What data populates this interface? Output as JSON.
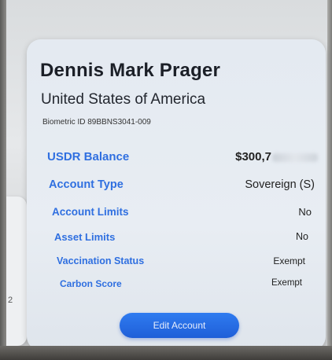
{
  "profile": {
    "name": "Dennis Mark Prager",
    "country": "United States of America",
    "biometric_id": "Biometric ID 89BBNS3041-009"
  },
  "details": [
    {
      "label": "USDR Balance",
      "value": "$300,7"
    },
    {
      "label": "Account Type",
      "value": "Sovereign (S)"
    },
    {
      "label": "Account Limits",
      "value": "No"
    },
    {
      "label": "Asset Limits",
      "value": "No"
    },
    {
      "label": "Vaccination Status",
      "value": "Exempt"
    },
    {
      "label": "Carbon Score",
      "value": "Exempt"
    }
  ],
  "actions": {
    "edit_label": "Edit Account"
  },
  "side_card": {
    "number": "2"
  },
  "colors": {
    "label_blue": "#2f6fe0",
    "button_blue": "#2467e0",
    "card_bg": "#e6ebf1"
  }
}
